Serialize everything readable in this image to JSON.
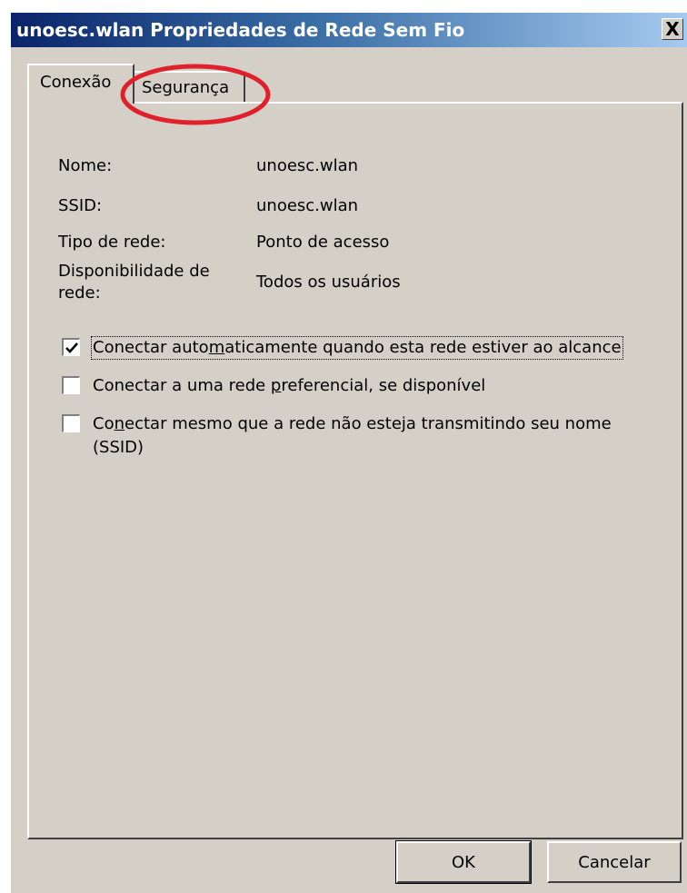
{
  "window": {
    "title": "unoesc.wlan Propriedades de Rede Sem Fio",
    "close_label": "X"
  },
  "tabs": [
    {
      "label": "Conexão",
      "selected": true
    },
    {
      "label": "Segurança",
      "selected": false,
      "highlighted": true
    }
  ],
  "properties": [
    {
      "label": "Nome:",
      "value": "unoesc.wlan"
    },
    {
      "label": "SSID:",
      "value": "unoesc.wlan"
    },
    {
      "label": "Tipo de rede:",
      "value": "Ponto de acesso"
    },
    {
      "label_line1": "Disponibilidade de",
      "label_line2": "rede:",
      "value": "Todos os usuários"
    }
  ],
  "options": [
    {
      "label_pre": "Conectar auto",
      "label_accel": "m",
      "label_post": "aticamente quando esta rede estiver ao alcance",
      "checked": true
    },
    {
      "label_pre": "Conectar a uma rede ",
      "label_accel": "p",
      "label_post": "referencial, se disponível",
      "checked": false
    },
    {
      "label_pre": "Co",
      "label_accel": "n",
      "label_post": "ectar mesmo que a rede não esteja transmitindo seu nome",
      "label_line2": "(SSID)",
      "checked": false
    }
  ],
  "buttons": {
    "ok": "OK",
    "cancel": "Cancelar"
  },
  "colors": {
    "highlight_circle": "#e0202a",
    "title_bar_start": "#0a246a",
    "title_bar_end": "#a6caf0",
    "dialog_bg": "#d4d0c8"
  }
}
